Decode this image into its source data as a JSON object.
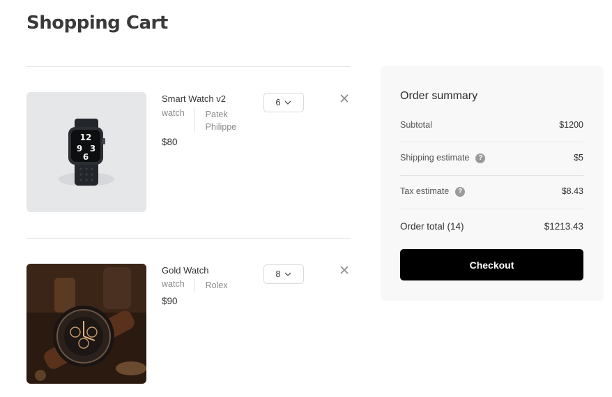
{
  "page": {
    "title": "Shopping Cart"
  },
  "items": [
    {
      "name": "Smart Watch v2",
      "category": "watch",
      "brand": "Patek Philippe",
      "price": "$80",
      "quantity": "6"
    },
    {
      "name": "Gold Watch",
      "category": "watch",
      "brand": "Rolex",
      "price": "$90",
      "quantity": "8"
    }
  ],
  "summary": {
    "title": "Order summary",
    "subtotal_label": "Subtotal",
    "subtotal_value": "$1200",
    "shipping_label": "Shipping estimate",
    "shipping_value": "$5",
    "tax_label": "Tax estimate",
    "tax_value": "$8.43",
    "total_label": "Order total (14)",
    "total_value": "$1213.43",
    "help_glyph": "?",
    "checkout_label": "Checkout"
  },
  "colors": {
    "checkout_bg": "#000000",
    "summary_bg": "#f8f8f8",
    "divider": "#e5e5e5"
  }
}
